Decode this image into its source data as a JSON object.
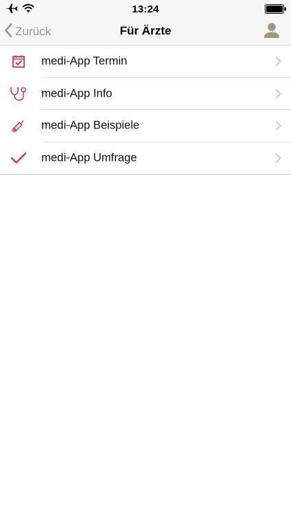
{
  "status_bar": {
    "time": "13:24",
    "icons": [
      "airplane-icon",
      "wifi-icon",
      "battery-icon"
    ]
  },
  "nav": {
    "back_label": "Zurück",
    "title": "Für Ärzte",
    "profile_icon": "person-icon"
  },
  "colors": {
    "accent": "#a8957a",
    "icon_red": "#d6344f",
    "chevron": "#c7c7cc"
  },
  "list": {
    "items": [
      {
        "label": "medi-App Termin",
        "icon": "calendar-check-icon"
      },
      {
        "label": "medi-App Info",
        "icon": "stethoscope-icon"
      },
      {
        "label": "medi-App Beispiele",
        "icon": "syringe-icon"
      },
      {
        "label": "medi-App Umfrage",
        "icon": "checkmark-icon"
      }
    ]
  }
}
